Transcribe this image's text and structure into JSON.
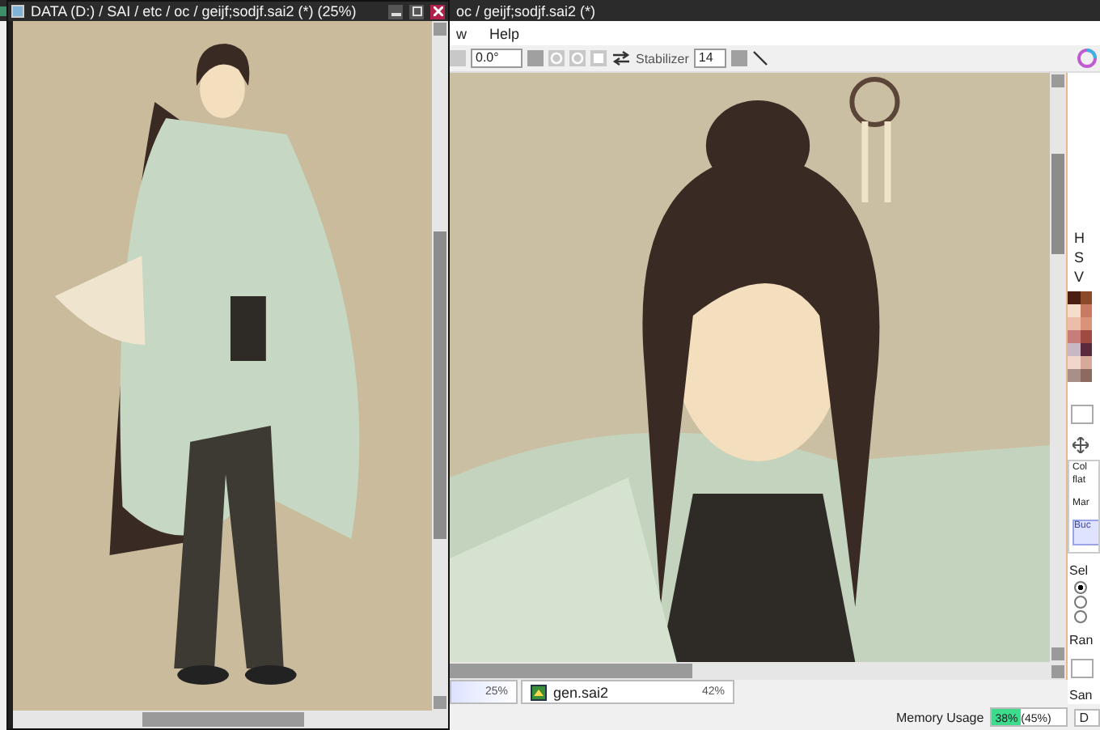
{
  "main_window": {
    "title": "oc / geijf;sodjf.sai2 (*)",
    "menu": [
      "w",
      "Help"
    ],
    "toolbar": {
      "angle": "0.0°",
      "stabilizer_label": "Stabilizer",
      "stabilizer": "14"
    },
    "panel": {
      "hsv_labels": [
        "H",
        "S",
        "V"
      ],
      "brush_texts": [
        "Col",
        "flat",
        "Mar"
      ],
      "selected_tool": "Buc",
      "selection_label": "Sel",
      "selection_options": [
        {
          "selected": true
        },
        {
          "selected": false
        },
        {
          "selected": false
        }
      ],
      "range_label": "Ran",
      "sample_label": "San"
    },
    "tabs": [
      {
        "zoom": "25%",
        "selected": true
      },
      {
        "name": "gen.sai2",
        "zoom": "42%",
        "selected": false
      }
    ],
    "status": {
      "memory_label": "Memory Usage",
      "memory": "38% (45%)",
      "level": 0.38,
      "cut_text": "D"
    }
  },
  "floating_window": {
    "title": "DATA (D:) / SAI / etc / oc / geijf;sodjf.sai2 (*) (25%)"
  }
}
